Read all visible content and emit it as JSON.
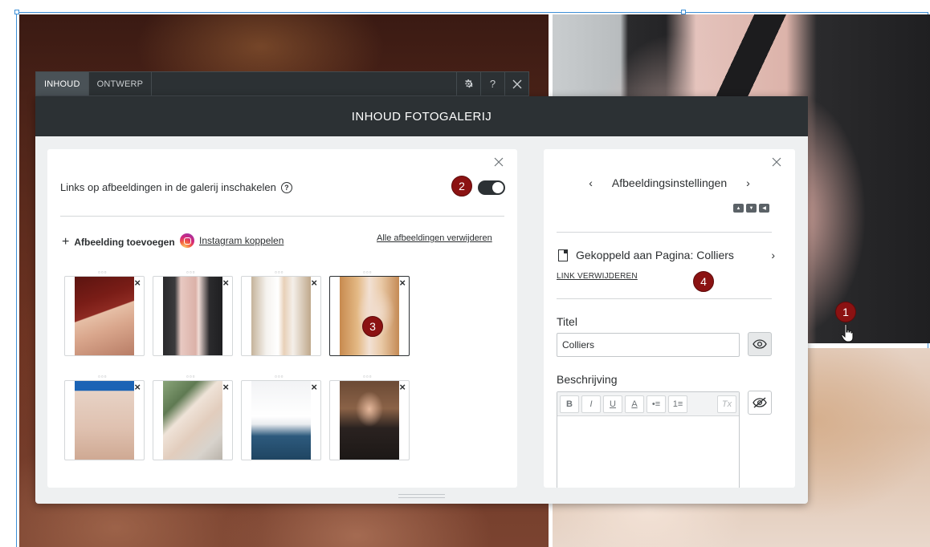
{
  "tabs": [
    {
      "label": "INHOUD"
    },
    {
      "label": "ONTWERP"
    }
  ],
  "tools": {
    "settings_icon": "gear-icon",
    "help": "?",
    "close_icon": "close-icon"
  },
  "dialog": {
    "title": "INHOUD FOTOGALERIJ"
  },
  "gallery_panel": {
    "toggle_label": "Links op afbeeldingen in de galerij inschakelen",
    "toggle_on": true,
    "add_image": "Afbeelding toevoegen",
    "instagram": "Instagram koppelen",
    "remove_all": "Alle afbeeldingen verwijderen",
    "thumbnails": [
      {
        "name": "thumb-hand-ring-box",
        "selected": false
      },
      {
        "name": "thumb-leather-jacket-watch",
        "selected": false
      },
      {
        "name": "thumb-white-blouse-rings",
        "selected": false
      },
      {
        "name": "thumb-necklace",
        "selected": true
      },
      {
        "name": "thumb-beige-trousers",
        "selected": false
      },
      {
        "name": "thumb-lace-dress-ring",
        "selected": false
      },
      {
        "name": "thumb-white-shirt-hands",
        "selected": false
      },
      {
        "name": "thumb-portrait-black-top",
        "selected": false
      }
    ]
  },
  "settings_panel": {
    "title": "Afbeeldingsinstellingen",
    "linked": "Gekoppeld aan Pagina: Colliers",
    "remove_link": "LINK VERWIJDEREN",
    "title_label": "Titel",
    "title_value": "Colliers",
    "description_label": "Beschrijving",
    "toolbar": [
      "B",
      "I",
      "U",
      "A",
      "•≡",
      "1≡",
      "Tx"
    ]
  },
  "badges": [
    "1",
    "2",
    "3",
    "4"
  ]
}
